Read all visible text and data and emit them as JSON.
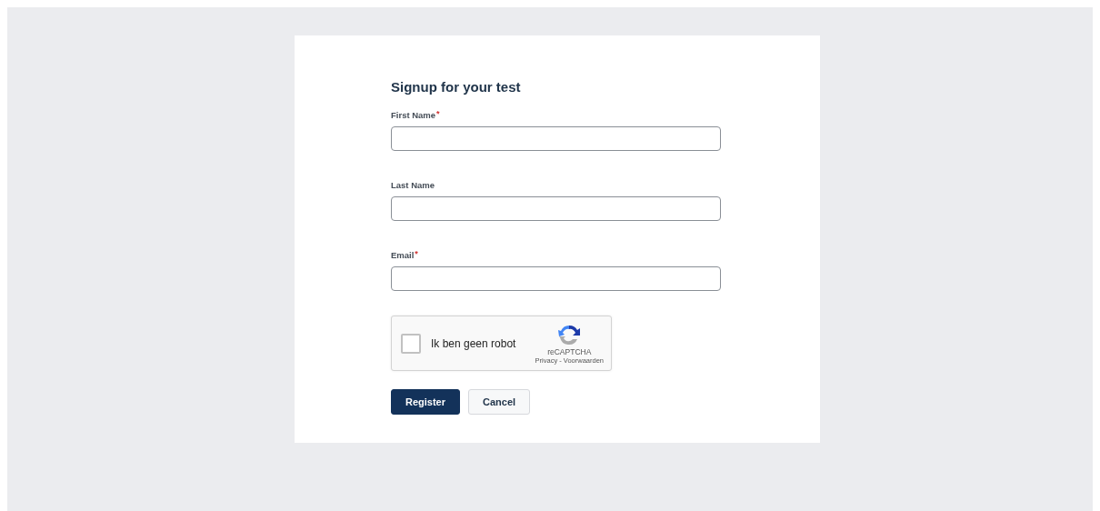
{
  "form": {
    "title": "Signup for your test",
    "fields": [
      {
        "label": "First Name",
        "required_mark": "*"
      },
      {
        "label": "Last Name"
      },
      {
        "label": "Email",
        "required_mark": "*"
      }
    ],
    "captcha": {
      "label": "Ik ben geen robot",
      "checked": false,
      "brand": "reCAPTCHA",
      "links": "Privacy - Voorwaarden"
    },
    "buttons": [
      {
        "label": "Register",
        "kind": "primary"
      },
      {
        "label": "Cancel",
        "kind": "secondary"
      }
    ]
  }
}
